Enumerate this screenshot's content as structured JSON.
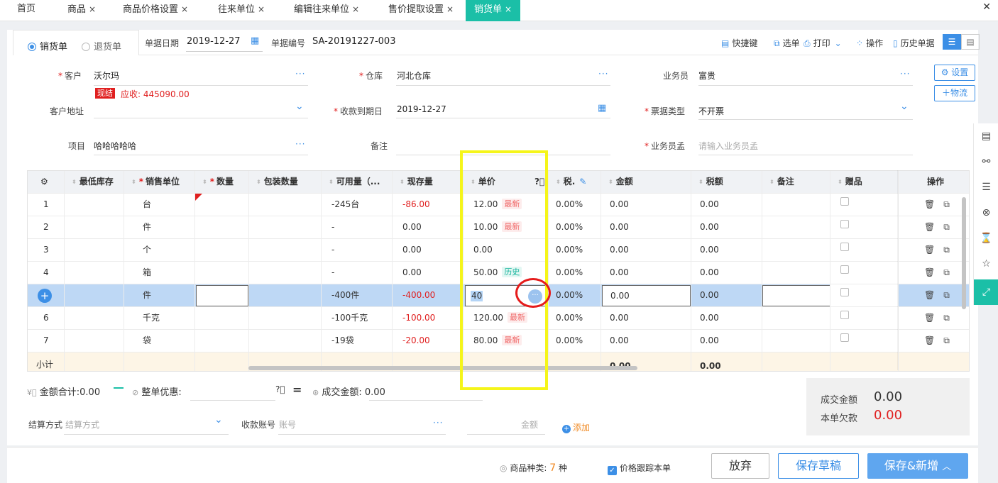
{
  "tabs": [
    {
      "label": "首页",
      "closable": false
    },
    {
      "label": "商品",
      "closable": true
    },
    {
      "label": "商品价格设置",
      "closable": true
    },
    {
      "label": "往来单位",
      "closable": true
    },
    {
      "label": "编辑往来单位",
      "closable": true
    },
    {
      "label": "售价提取设置",
      "closable": true
    },
    {
      "label": "销货单",
      "closable": true,
      "active": true
    }
  ],
  "tab_close_glyph": "×",
  "window_close_glyph": "✕",
  "doc_type": {
    "sale": "销货单",
    "return": "退货单"
  },
  "header": {
    "date_label": "单据日期",
    "date_value": "2019-12-27",
    "no_label": "单据编号",
    "no_value": "SA-20191227-003"
  },
  "toolbar": {
    "shortcut": "快捷键",
    "select": "选单",
    "print": "打印",
    "action": "操作",
    "history": "历史单据"
  },
  "form": {
    "customer_label": "客户",
    "customer_value": "沃尔玛",
    "cash_tag": "现结",
    "receivable": "应收: 445090.00",
    "warehouse_label": "仓库",
    "warehouse_value": "河北仓库",
    "salesman_label": "业务员",
    "salesman_value": "富贵",
    "address_label": "客户地址",
    "due_label": "收款到期日",
    "due_value": "2019-12-27",
    "invoice_label": "票据类型",
    "invoice_value": "不开票",
    "project_label": "项目",
    "project_value": "哈哈哈哈哈",
    "remark_label": "备注",
    "salesman2_label": "业务员孟",
    "salesman2_placeholder": "请输入业务员孟",
    "settings_btn": "设置",
    "logistics_btn": "物流",
    "more": "···"
  },
  "grid": {
    "headers": {
      "min_stock": "最低库存",
      "unit": "销售单位",
      "qty": "数量",
      "pack_qty": "包装数量",
      "available": "可用量（...",
      "stock": "现存量",
      "price": "单价",
      "tax": "税.",
      "amount": "金额",
      "tax_amount": "税额",
      "note": "备注",
      "gift": "赠品",
      "ops": "操作"
    },
    "rows": [
      {
        "no": "1",
        "unit": "台",
        "available": "-245台",
        "stock": "-86.00",
        "price": "12.00",
        "tag": "最新",
        "tax": "0.00%",
        "amount": "0.00",
        "tax_amount": "0.00"
      },
      {
        "no": "2",
        "unit": "件",
        "available": "-",
        "stock": "0.00",
        "price": "10.00",
        "tag": "最新",
        "tax": "0.00%",
        "amount": "0.00",
        "tax_amount": "0.00"
      },
      {
        "no": "3",
        "unit": "个",
        "available": "-",
        "stock": "0.00",
        "price": "0.00",
        "tag": "",
        "tax": "0.00%",
        "amount": "0.00",
        "tax_amount": "0.00"
      },
      {
        "no": "4",
        "unit": "箱",
        "available": "-",
        "stock": "0.00",
        "price": "50.00",
        "tag": "历史",
        "tax": "0.00%",
        "amount": "0.00",
        "tax_amount": "0.00"
      },
      {
        "no": "",
        "unit": "件",
        "available": "-400件",
        "stock": "-400.00",
        "price": "40",
        "tag": "",
        "tax": "0.00%",
        "amount": "0.00",
        "tax_amount": "0.00"
      },
      {
        "no": "6",
        "unit": "千克",
        "available": "-100千克",
        "stock": "-100.00",
        "price": "120.00",
        "tag": "最新",
        "tax": "0.00%",
        "amount": "0.00",
        "tax_amount": "0.00"
      },
      {
        "no": "7",
        "unit": "袋",
        "available": "-19袋",
        "stock": "-20.00",
        "price": "80.00",
        "tag": "最新",
        "tax": "0.00%",
        "amount": "0.00",
        "tax_amount": "0.00"
      }
    ],
    "subtotal_label": "小计",
    "subtotal_amount": "0.00",
    "subtotal_tax": "0.00"
  },
  "totals": {
    "amount_label": "金额合计:",
    "amount_value": "0.00",
    "discount_label": "整单优惠:",
    "deal_label": "成交金额:",
    "deal_value": "0.00"
  },
  "settle": {
    "method_label": "结算方式",
    "method_placeholder": "结算方式",
    "account_label": "收款账号",
    "account_placeholder": "账号",
    "amount_placeholder": "金额",
    "add": "添加"
  },
  "summary": {
    "deal_label": "成交金额",
    "deal_value": "0.00",
    "owe_label": "本单欠款",
    "owe_value": "0.00"
  },
  "footer": {
    "kinds_label": "商品种类:",
    "kinds_value": "7",
    "kinds_unit": "种",
    "track_label": "价格跟踪本单",
    "discard": "放弃",
    "save_draft": "保存草稿",
    "save_new": "保存&新增"
  },
  "colors": {
    "accent": "#1bbfa7",
    "blue": "#3c8fe6",
    "red": "#e02020"
  }
}
